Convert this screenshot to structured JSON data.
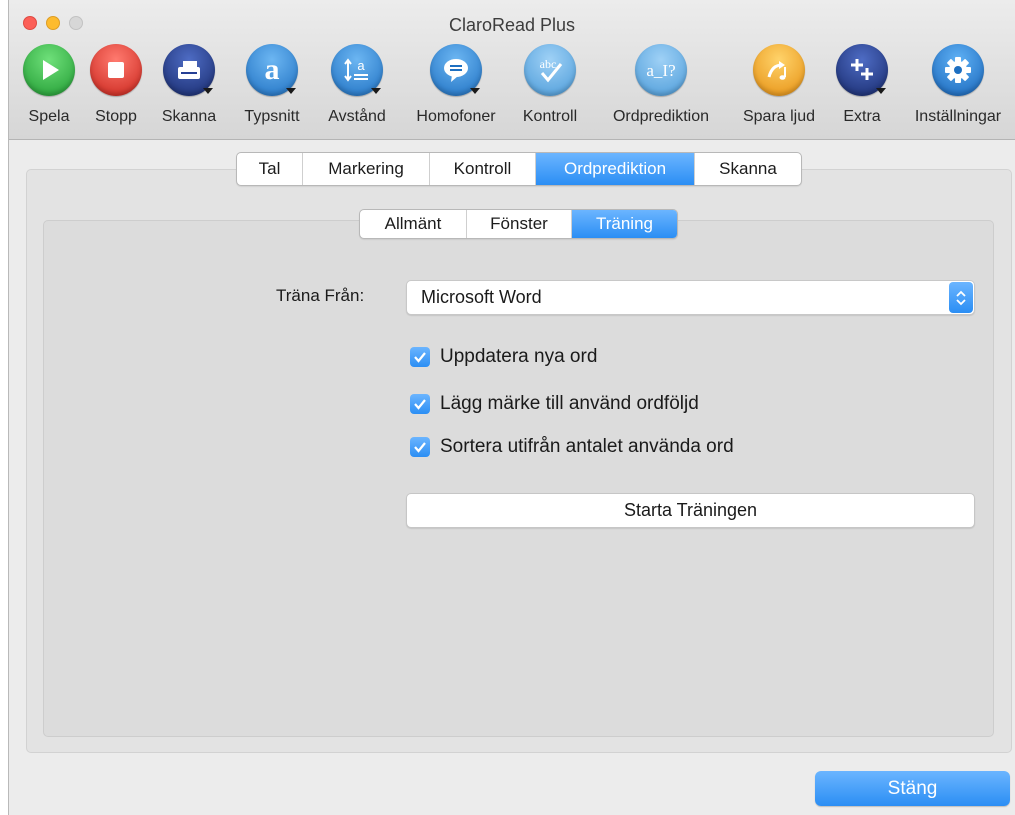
{
  "window": {
    "title": "ClaroRead Plus"
  },
  "toolbar": {
    "items": [
      {
        "label": "Spela",
        "icon": "play-icon",
        "color": "#2fb342"
      },
      {
        "label": "Stopp",
        "icon": "stop-icon",
        "color": "#e23b30"
      },
      {
        "label": "Skanna",
        "icon": "scanner-icon",
        "color": "#253f94"
      },
      {
        "label": "Typsnitt",
        "icon": "font-a-icon",
        "color": "#2b85d8"
      },
      {
        "label": "Avstånd",
        "icon": "line-spacing-icon",
        "color": "#2b85d8"
      },
      {
        "label": "Homofoner",
        "icon": "speech-bubble-icon",
        "color": "#2b85d8"
      },
      {
        "label": "Kontroll",
        "icon": "spellcheck-icon",
        "color": "#56a8e4"
      },
      {
        "label": "Ordprediktion",
        "icon": "word-prediction-icon",
        "color": "#56a8e4"
      },
      {
        "label": "Spara ljud",
        "icon": "save-audio-icon",
        "color": "#f4a423"
      },
      {
        "label": "Extra",
        "icon": "extra-plus-icon",
        "color": "#253f94"
      },
      {
        "label": "Inställningar",
        "icon": "gear-icon",
        "color": "#1f7fd8"
      }
    ]
  },
  "main_tabs": {
    "items": [
      "Tal",
      "Markering",
      "Kontroll",
      "Ordprediktion",
      "Skanna"
    ],
    "active": "Ordprediktion"
  },
  "sub_tabs": {
    "items": [
      "Allmänt",
      "Fönster",
      "Träning"
    ],
    "active": "Träning"
  },
  "training": {
    "source_label": "Träna Från:",
    "source_value": "Microsoft Word",
    "options": [
      {
        "label": "Uppdatera nya ord",
        "checked": true
      },
      {
        "label": "Lägg märke till använd ordföljd",
        "checked": true
      },
      {
        "label": "Sortera utifrån antalet använda ord",
        "checked": true
      }
    ],
    "start_button": "Starta Träningen"
  },
  "footer": {
    "close_button": "Stäng"
  },
  "colors": {
    "accent": "#2b8ef4"
  }
}
